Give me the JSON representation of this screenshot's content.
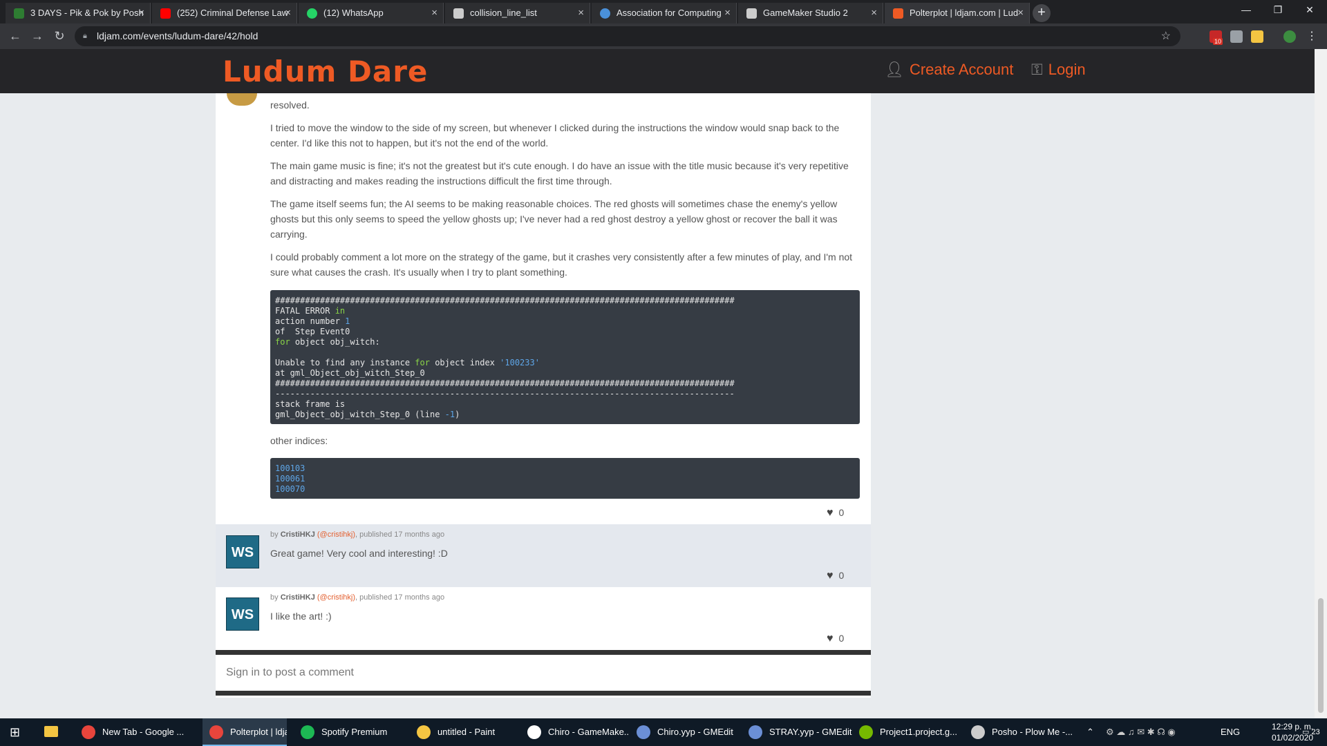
{
  "browser": {
    "tabs": [
      {
        "title": "3 DAYS - Pik & Pok by Posh",
        "color": "#2e7d32"
      },
      {
        "title": "(252) Criminal Defense Law",
        "color": "#ff0000"
      },
      {
        "title": "(12) WhatsApp",
        "color": "#25d366"
      },
      {
        "title": "collision_line_list",
        "color": "#cccccc"
      },
      {
        "title": "Association for Computing",
        "color": "#4a90d9"
      },
      {
        "title": "GameMaker Studio 2",
        "color": "#cccccc"
      },
      {
        "title": "Polterplot | ldjam.com | Lud",
        "color": "#ee5a24"
      }
    ],
    "url": "ldjam.com/events/ludum-dare/42/hold",
    "ext_badge": "10"
  },
  "site": {
    "logo": "Ludum Dare",
    "create_account": "Create Account",
    "login": "Login"
  },
  "post": {
    "p0": "resolved.",
    "p1": "I tried to move the window to the side of my screen, but whenever I clicked during the instructions the window would snap back to the center. I'd like this not to happen, but it's not the end of the world.",
    "p2": "The main game music is fine; it's not the greatest but it's cute enough. I do have an issue with the title music because it's very repetitive and distracting and makes reading the instructions difficult the first time through.",
    "p3": "The game itself seems fun; the AI seems to be making reasonable choices. The red ghosts will sometimes chase the enemy's yellow ghosts but this only seems to speed the yellow ghosts up; I've never had a red ghost destroy a yellow ghost or recover the ball it was carrying.",
    "p4": "I could probably comment a lot more on the strategy of the game, but it crashes very consistently after a few minutes of play, and I'm not sure what causes the crash. It's usually when I try to plant something.",
    "other_indices_label": "other indices:",
    "code2": [
      "100103",
      "100061",
      "100070"
    ],
    "likes": "0"
  },
  "comments": [
    {
      "by": "by",
      "author": "CristiHKJ",
      "handle": "(@cristihkj)",
      "published": ", published 17 months ago",
      "text": "Great game! Very cool and interesting! :D",
      "likes": "0"
    },
    {
      "by": "by",
      "author": "CristiHKJ",
      "handle": "(@cristihkj)",
      "published": ", published 17 months ago",
      "text": "I like the art! :)",
      "likes": "0"
    }
  ],
  "avatar_text": "WS",
  "sign_in": "Sign in to post a comment",
  "taskbar": {
    "items": [
      {
        "label": "New Tab - Google ...",
        "color": "#e8453c"
      },
      {
        "label": "Polterplot | ldjam.c...",
        "color": "#e8453c"
      },
      {
        "label": "Spotify Premium",
        "color": "#1db954"
      },
      {
        "label": "untitled - Paint",
        "color": "#f4c542"
      },
      {
        "label": "Chiro - GameMake...",
        "color": "#ffffff"
      },
      {
        "label": "Chiro.yyp - GMEdit",
        "color": "#6b8fd6"
      },
      {
        "label": "STRAY.yyp - GMEdit",
        "color": "#6b8fd6"
      },
      {
        "label": "Project1.project.g...",
        "color": "#76b900"
      },
      {
        "label": "Posho - Plow Me -...",
        "color": "#cccccc"
      }
    ],
    "lang": "ENG",
    "time": "12:29 p. m.",
    "date": "01/02/2020",
    "notif": "23"
  }
}
